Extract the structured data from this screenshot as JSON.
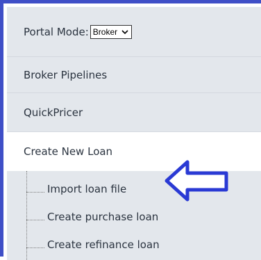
{
  "menu": {
    "portal_mode": {
      "label": "Portal Mode:",
      "selected": "Broker",
      "chevron_icon": "chevron-down-icon"
    },
    "items": [
      {
        "label": "Broker Pipelines"
      },
      {
        "label": "QuickPricer"
      },
      {
        "label": "Create New Loan"
      }
    ],
    "submenu": [
      {
        "label": "Import loan file"
      },
      {
        "label": "Create purchase loan"
      },
      {
        "label": "Create refinance loan"
      }
    ]
  },
  "annotation": {
    "arrow_icon": "left-arrow-icon",
    "arrow_color": "#2a3ad4"
  },
  "colors": {
    "frame_border": "#3f4fc7",
    "menu_bg": "#e3e7ec",
    "text": "#2b3440"
  }
}
